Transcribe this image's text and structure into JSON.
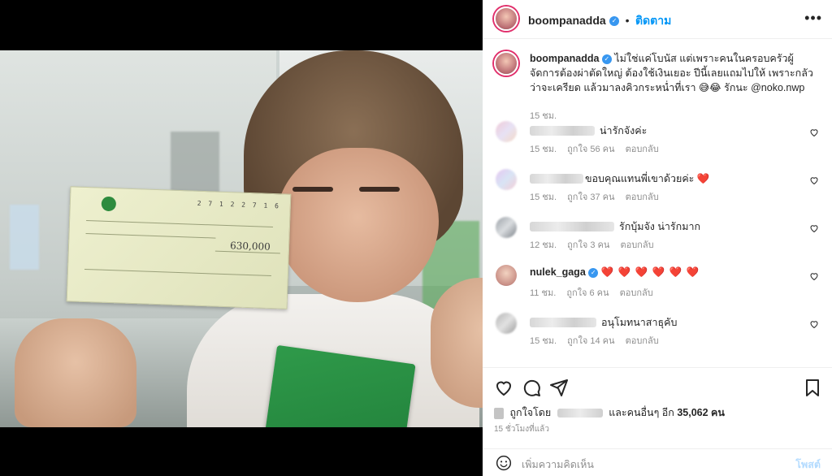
{
  "post": {
    "username": "boompanadda",
    "follow_label": "ติดตาม",
    "caption": "ไม่ใช่แค่โบนัส แต่เพราะคนในครอบครัวผู้จัดการต้องผ่าตัดใหญ่ ต้องใช้เงินเยอะ ปีนี้เลยแถมไปให้ เพราะกลัวว่าจะเครียด แล้วมาลงคิวกระหน่ำที่เรา 😅😂 รักนะ @noko.nwp",
    "caption_time": "15 ชม.",
    "cheque_amount": "630,000",
    "cheque_date": "2 7 1 2 2 7 1 6"
  },
  "comments": [
    {
      "text": "น่ารักจังค่ะ",
      "time": "15 ชม.",
      "likes": "ถูกใจ 56 คน",
      "reply": "ตอบกลับ"
    },
    {
      "text": "ขอบคุณแทนพี่เขาด้วยค่ะ ❤️",
      "time": "15 ชม.",
      "likes": "ถูกใจ 37 คน",
      "reply": "ตอบกลับ"
    },
    {
      "text": "รักบุ้มจัง น่ารักมาก",
      "time": "12 ชม.",
      "likes": "ถูกใจ 3 คน",
      "reply": "ตอบกลับ"
    },
    {
      "username": "nulek_gaga",
      "text": "❤️ ❤️ ❤️ ❤️ ❤️ ❤️",
      "time": "11 ชม.",
      "likes": "ถูกใจ 6 คน",
      "reply": "ตอบกลับ"
    },
    {
      "text": "อนุโมทนาสาธุคับ",
      "time": "15 ชม.",
      "likes": "ถูกใจ 14 คน",
      "reply": "ตอบกลับ"
    }
  ],
  "likes_summary": {
    "prefix": "ถูกใจโดย",
    "middle": "และคนอื่นๆ อีก",
    "count": "35,062 คน"
  },
  "timestamp": "15 ชั่วโมงที่แล้ว",
  "add_comment": {
    "placeholder": "เพิ่มความคิดเห็น",
    "post_label": "โพสต์"
  },
  "icons": [
    "heart-icon",
    "comment-icon",
    "share-icon",
    "bookmark-icon",
    "more-icon",
    "emoji-icon",
    "verified-icon"
  ],
  "colors": {
    "accent": "#0095f6",
    "verified": "#3897f0",
    "heart": "#ed4956"
  }
}
